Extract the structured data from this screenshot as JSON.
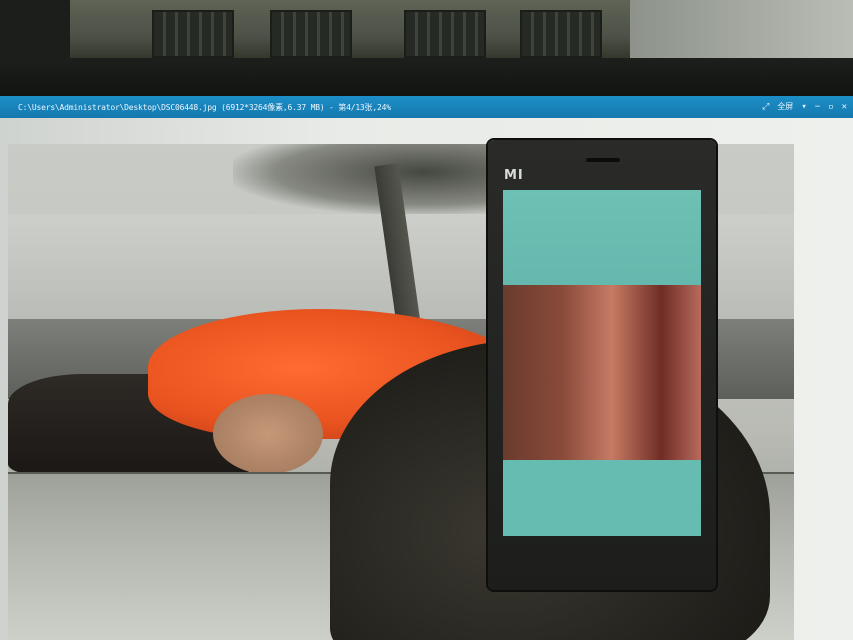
{
  "viewer": {
    "title": "C:\\Users\\Administrator\\Desktop\\DSC06448.jpg (6912*3264像素,6.37 MB) - 第4/13张,24%",
    "controls": {
      "fullscreen_label": "全屏",
      "menu_icon": "chevron-down-icon",
      "minimize_icon": "minimize-icon",
      "maximize_icon": "maximize-icon",
      "close_icon": "close-icon"
    }
  },
  "phone": {
    "brand": "MI"
  },
  "colors": {
    "titlebar": "#1479ad",
    "coat": "#e9531f",
    "phone_screen": "#5fb3a8"
  }
}
